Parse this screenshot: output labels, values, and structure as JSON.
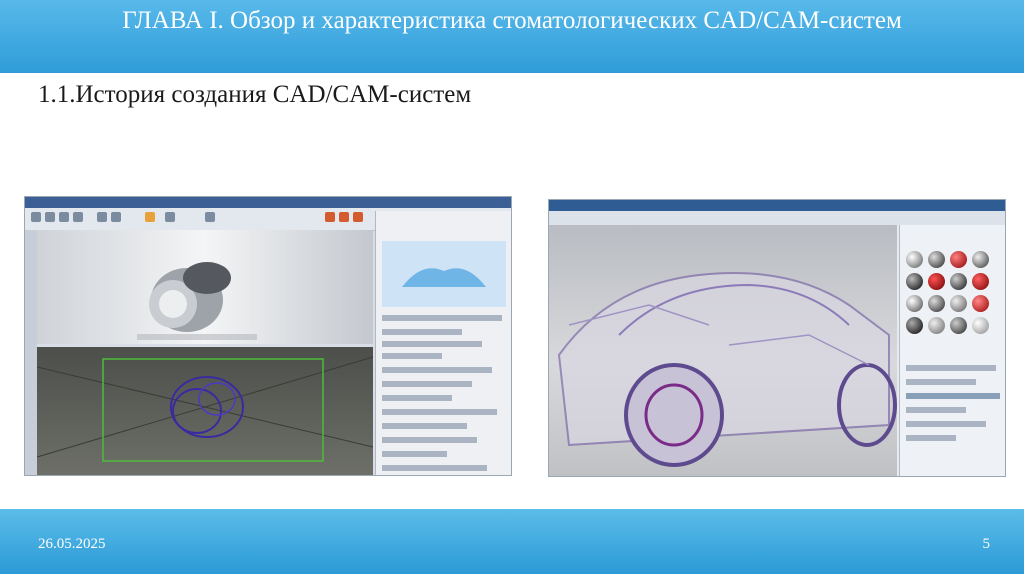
{
  "slide": {
    "header_title": "ГЛАВА I. Обзор и характеристика стоматологических CAD/CAM-систем",
    "subtitle": "1.1.История создания CAD/CAM-систем",
    "footer_date": "26.05.2025",
    "page_number": "5"
  },
  "colors": {
    "header_bg": "#3aa6df",
    "footer_bg": "#3aa6df",
    "text": "#1a1a1a"
  },
  "images": [
    {
      "name": "cad-software-wheel-screenshot",
      "icon": "cad-wheel-model"
    },
    {
      "name": "cad-software-car-wireframe-screenshot",
      "icon": "car-wireframe"
    }
  ]
}
